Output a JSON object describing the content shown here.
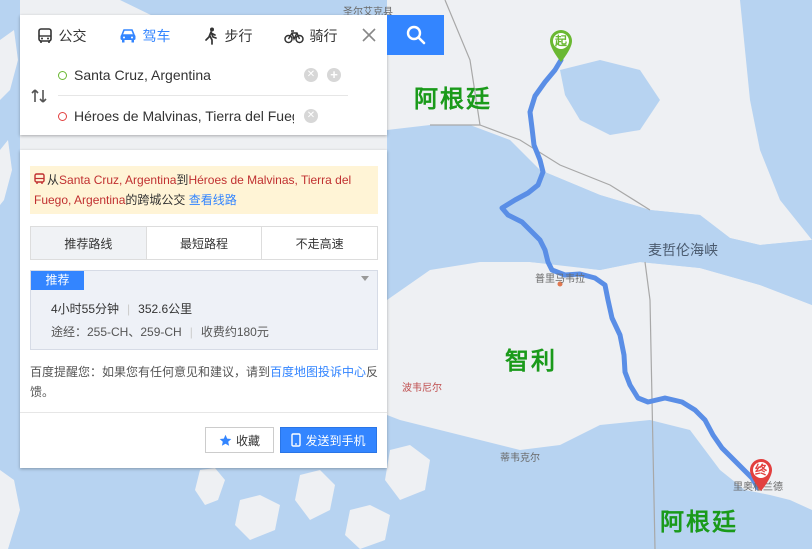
{
  "mode_tabs": [
    {
      "label": "公交",
      "icon": "bus-icon",
      "active": false
    },
    {
      "label": "驾车",
      "icon": "car-icon",
      "active": true
    },
    {
      "label": "步行",
      "icon": "walk-icon",
      "active": false
    },
    {
      "label": "骑行",
      "icon": "bike-icon",
      "active": false
    }
  ],
  "route": {
    "start": "Santa Cruz, Argentina",
    "end": "Héroes de Malvinas, Tierra del Fuego"
  },
  "notice": {
    "prefix": "从",
    "start": "Santa Cruz, Argentina",
    "middle": "到",
    "end": "Héroes de Malvinas, Tierra del Fuego, Argentina",
    "suffix": "的跨城公交",
    "link": "查看线路"
  },
  "route_tabs": [
    {
      "label": "推荐路线",
      "active": true
    },
    {
      "label": "最短路程",
      "active": false
    },
    {
      "label": "不走高速",
      "active": false
    }
  ],
  "plan": {
    "badge": "推荐",
    "duration": "4小时55分钟",
    "distance": "352.6公里",
    "via": "途经：255-CH、259-CH",
    "toll": "收费约180元"
  },
  "tip": {
    "before": "百度提醒您：如果您有任何意见和建议，请到",
    "link": "百度地图投诉中心",
    "after": "反馈。"
  },
  "buttons": {
    "collect": "收藏",
    "send": "发送到手机"
  },
  "map": {
    "countries": [
      "阿根廷",
      "智利",
      "阿根廷"
    ],
    "strait": "麦哲伦海峡",
    "towns": [
      "圣尔艾克县",
      "普里马韦拉",
      "波韦尼尔",
      "蒂韦克尔",
      "里奥格兰德"
    ],
    "start_marker": "起",
    "end_marker": "终",
    "route_color": "#5a8ee6",
    "land_color": "#eef0f3",
    "water_color": "#b7d3f1",
    "start_color": "#6ab832",
    "end_color": "#e2403f"
  }
}
